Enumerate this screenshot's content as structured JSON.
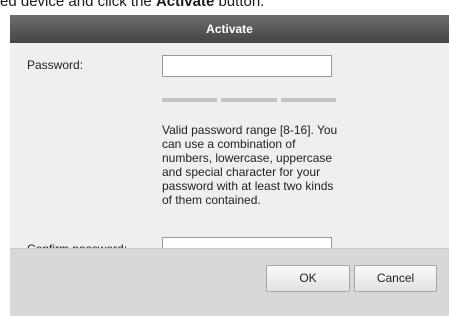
{
  "instruction": {
    "before": "ed device and click the ",
    "bold": "Activate",
    "after": " button."
  },
  "dialog": {
    "title": "Activate",
    "password_label": "Password:",
    "password_value": "",
    "strength_segments": 3,
    "hint": "Valid password range [8-16]. You can use a combination of numbers, lowercase, uppercase and special character for your password with at least two kinds of them contained.",
    "confirm_label": "Confirm password:",
    "confirm_value": "",
    "ok_label": "OK",
    "cancel_label": "Cancel"
  }
}
